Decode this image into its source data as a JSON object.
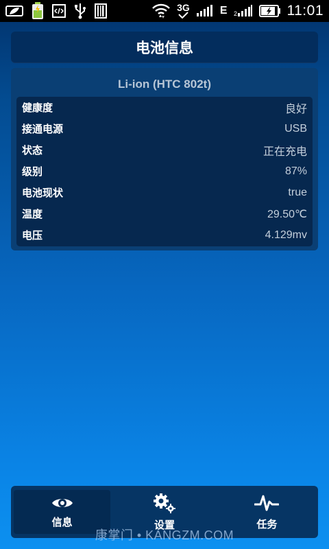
{
  "status_bar": {
    "network_type": "3G",
    "data_type": "E",
    "time": "11:01",
    "left_icons": [
      "leaf-icon",
      "battery-charging-icon",
      "code-icon",
      "usb-icon",
      "barcode-icon"
    ],
    "right_icons": [
      "wifi-icon",
      "signal-icon",
      "signal-icon-2",
      "battery-icon"
    ]
  },
  "header": {
    "title": "电池信息"
  },
  "battery": {
    "model": "Li-ion (HTC 802t)",
    "rows": [
      {
        "label": "健康度",
        "value": "良好"
      },
      {
        "label": "接通电源",
        "value": "USB"
      },
      {
        "label": "状态",
        "value": "正在充电"
      },
      {
        "label": "级别",
        "value": "87%"
      },
      {
        "label": "电池现状",
        "value": "true"
      },
      {
        "label": "温度",
        "value": "29.50℃"
      },
      {
        "label": "电压",
        "value": "4.129mv"
      }
    ]
  },
  "nav": {
    "items": [
      {
        "label": "信息",
        "icon": "eye-icon",
        "active": true
      },
      {
        "label": "设置",
        "icon": "gears-icon",
        "active": false
      },
      {
        "label": "任务",
        "icon": "pulse-icon",
        "active": false
      }
    ]
  },
  "watermark": "康掌门 • KANGZM.COM",
  "colors": {
    "background_top": "#02316a",
    "background_bottom": "#0c90f0",
    "panel": "#032d5d",
    "value_text": "#c4cfdb"
  }
}
